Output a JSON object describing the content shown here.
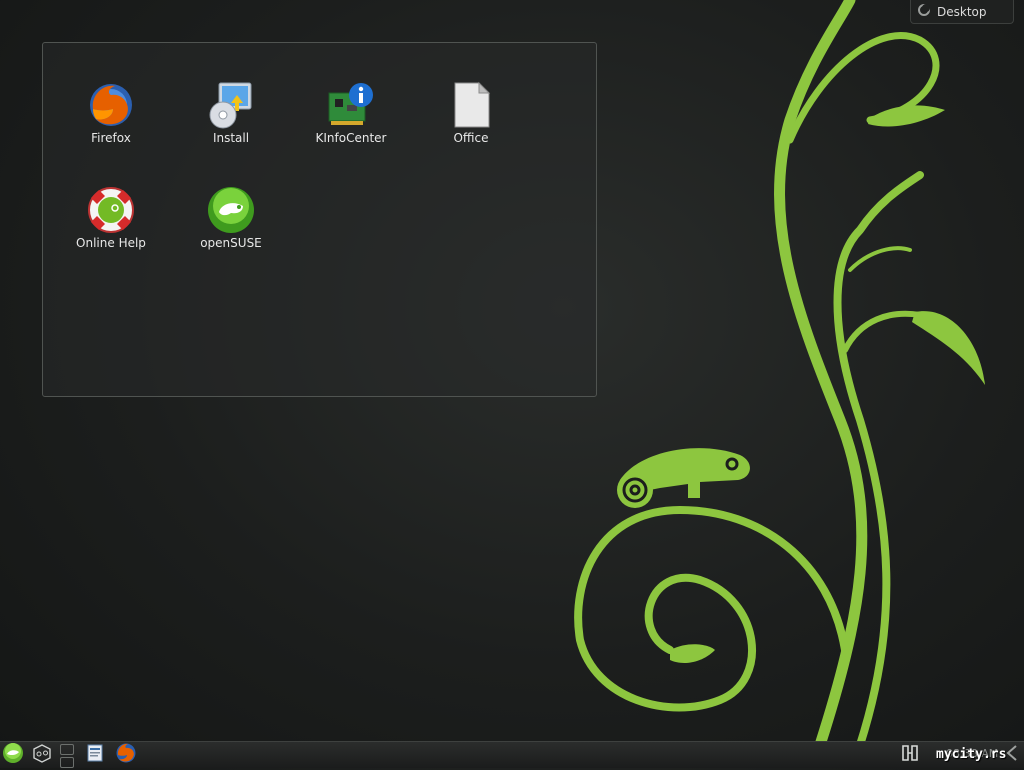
{
  "activity": {
    "label": "Desktop"
  },
  "desktop_icons": [
    {
      "label": "Firefox"
    },
    {
      "label": "Install"
    },
    {
      "label": "KInfoCenter"
    },
    {
      "label": "Office"
    },
    {
      "label": "Online Help"
    },
    {
      "label": "openSUSE"
    }
  ],
  "panel": {
    "clock": "08:38 AM",
    "watermark": "mycity.rs",
    "icons": [
      "kickoff-launcher-icon",
      "activity-manager-icon",
      "pager-icon",
      "task-notes-icon",
      "firefox-icon",
      "device-notifier-icon",
      "panel-toolbox-icon"
    ]
  },
  "colors": {
    "accent_green": "#8dc63f",
    "background": "#1c1e1d",
    "folder_border": "#505451"
  }
}
